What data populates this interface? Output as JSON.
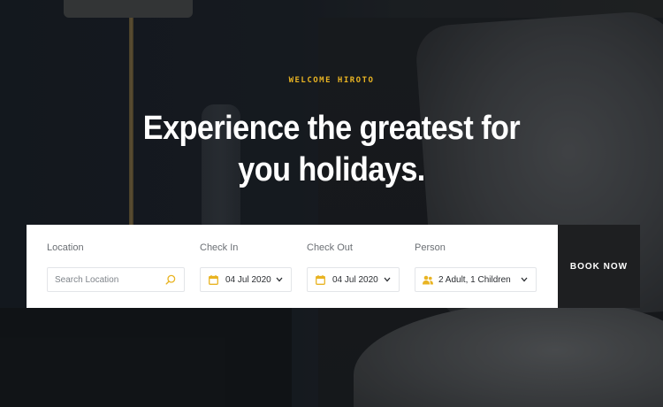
{
  "hero": {
    "welcome": "WELCOME HIROTO",
    "headline_line1": "Experience the greatest for",
    "headline_line2": "you holidays."
  },
  "search": {
    "location": {
      "label": "Location",
      "placeholder": "Search Location",
      "icon": "search-icon"
    },
    "check_in": {
      "label": "Check In",
      "value": "04 Jul 2020",
      "icon": "calendar-icon"
    },
    "check_out": {
      "label": "Check Out",
      "value": "04 Jul 2020",
      "icon": "calendar-icon"
    },
    "person": {
      "label": "Person",
      "value": "2 Adult, 1 Children",
      "icon": "people-icon"
    },
    "book_button": "BOOK NOW"
  },
  "colors": {
    "accent": "#e9b423",
    "button_bg": "#1e1f21",
    "text": "#2a2d31",
    "label": "#6b6f74"
  }
}
